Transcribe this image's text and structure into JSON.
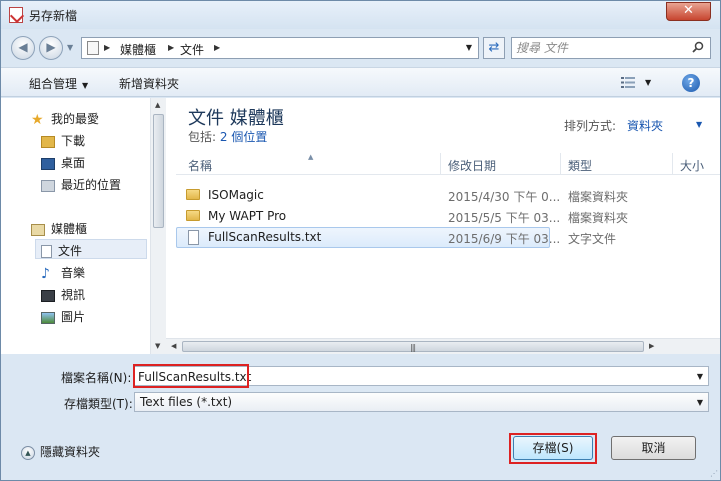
{
  "window": {
    "title": "另存新檔",
    "close_label": "✕"
  },
  "address": {
    "crumbs": [
      "媒體櫃",
      "文件"
    ],
    "search_placeholder": "搜尋 文件"
  },
  "toolbar": {
    "organize_label": "組合管理",
    "new_folder_label": "新增資料夾",
    "help_label": "?"
  },
  "nav": {
    "favorites_label": "我的最愛",
    "favorites": [
      "下載",
      "桌面",
      "最近的位置"
    ],
    "libraries_label": "媒體櫃",
    "libraries": [
      "文件",
      "音樂",
      "視訊",
      "圖片"
    ]
  },
  "library": {
    "title": "文件 媒體櫃",
    "includes_prefix": "包括:",
    "includes_link": "2 個位置",
    "arrange_label": "排列方式:",
    "arrange_value": "資料夾"
  },
  "columns": [
    "名稱",
    "修改日期",
    "類型",
    "大小"
  ],
  "files": [
    {
      "name": "ISOMagic",
      "date": "2015/4/30 下午 0...",
      "type": "檔案資料夾",
      "kind": "folder"
    },
    {
      "name": "My WAPT Pro",
      "date": "2015/5/5 下午 03...",
      "type": "檔案資料夾",
      "kind": "folder"
    },
    {
      "name": "FullScanResults.txt",
      "date": "2015/6/9 下午 03...",
      "type": "文字文件",
      "kind": "file"
    }
  ],
  "form": {
    "filename_label": "檔案名稱(N):",
    "filename_value": "FullScanResults.txt",
    "filetype_label": "存檔類型(T):",
    "filetype_value": "Text files (*.txt)",
    "hide_folders_label": "隱藏資料夾",
    "save_label": "存檔(S)",
    "cancel_label": "取消"
  },
  "colors": {
    "highlight": "#dd2222",
    "accent": "#1a57b0",
    "window_bg": "#dbe7f3"
  }
}
